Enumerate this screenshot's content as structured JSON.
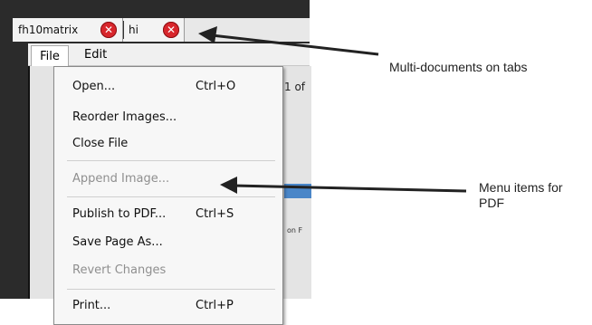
{
  "tabs": [
    {
      "label": "fh10matrix"
    },
    {
      "label": "hi"
    }
  ],
  "menubar": {
    "file": "File",
    "edit": "Edit"
  },
  "viewer": {
    "page_indicator": "1  of",
    "column_fragment": "on F"
  },
  "file_menu": {
    "items": [
      {
        "label": "Open...",
        "shortcut": "Ctrl+O"
      },
      {
        "label": "Reorder Images..."
      },
      {
        "label": "Close File"
      },
      {
        "label": "Append Image..."
      },
      {
        "label": "Publish to PDF...",
        "shortcut": "Ctrl+S"
      },
      {
        "label": "Save Page As..."
      },
      {
        "label": "Revert Changes"
      },
      {
        "label": "Print...",
        "shortcut": "Ctrl+P"
      }
    ]
  },
  "annotations": {
    "tabs_note": "Multi-documents on tabs",
    "pdf_note": "Menu items for PDF"
  },
  "colors": {
    "close_button": "#d8262c",
    "highlight_bar": "#4a86c8"
  }
}
